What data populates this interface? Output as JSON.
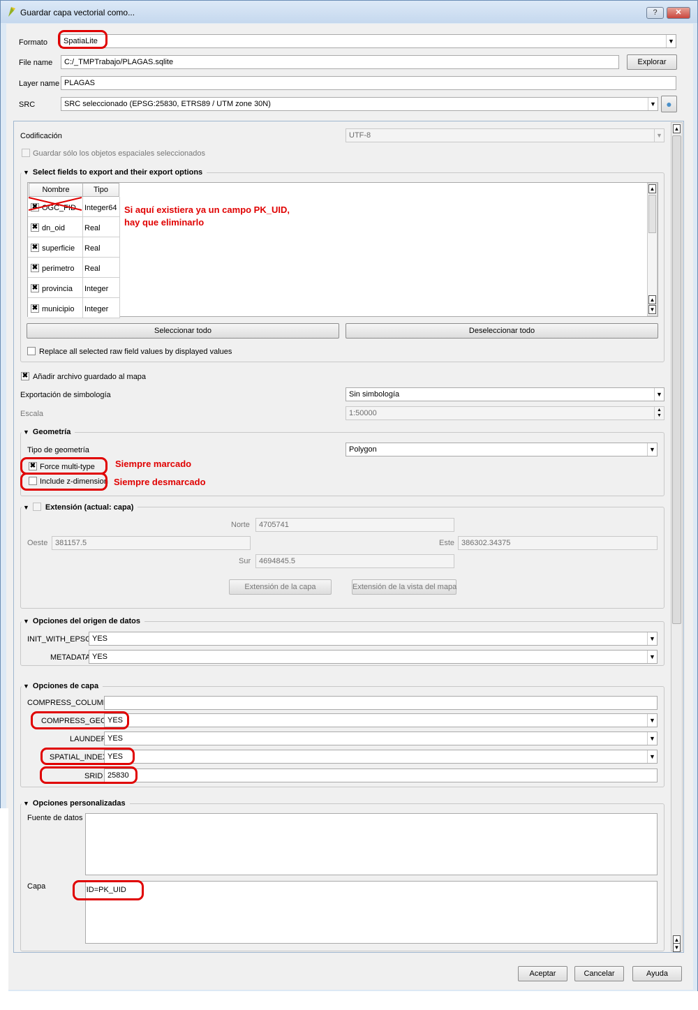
{
  "window": {
    "title": "Guardar capa vectorial como...",
    "help_label": "?",
    "close_label": "✕"
  },
  "top": {
    "format_label": "Formato",
    "format_value": "SpatiaLite",
    "filename_label": "File name",
    "filename_value": "C:/_TMPTrabajo/PLAGAS.sqlite",
    "browse_label": "Explorar",
    "layername_label": "Layer name",
    "layername_value": "PLAGAS",
    "src_label": "SRC",
    "src_value": "SRC seleccionado (EPSG:25830, ETRS89 / UTM zone 30N)"
  },
  "encoding": {
    "label": "Codificación",
    "value": "UTF-8",
    "selected_only_label": "Guardar sólo los objetos espaciales seleccionados"
  },
  "fields": {
    "title": "Select fields to export and their export options",
    "col_name": "Nombre",
    "col_type": "Tipo",
    "rows": [
      {
        "name": "OGC_FID",
        "type": "Integer64"
      },
      {
        "name": "dn_oid",
        "type": "Real"
      },
      {
        "name": "superficie",
        "type": "Real"
      },
      {
        "name": "perimetro",
        "type": "Real"
      },
      {
        "name": "provincia",
        "type": "Integer"
      },
      {
        "name": "municipio",
        "type": "Integer"
      }
    ],
    "select_all_label": "Seleccionar todo",
    "deselect_all_label": "Deseleccionar todo",
    "replace_label": "Replace all selected raw field values by displayed values"
  },
  "notes": {
    "pkuid_line1": "Si aquí existiera ya un campo PK_UID,",
    "pkuid_line2": "hay que eliminarlo",
    "always_checked": "Siempre marcado",
    "always_unchecked": "Siempre desmarcado"
  },
  "options": {
    "add_to_map_label": "Añadir archivo guardado al mapa",
    "symbology_label": "Exportación de simbología",
    "symbology_value": "Sin simbología",
    "scale_label": "Escala",
    "scale_value": "1:50000"
  },
  "geometry": {
    "title": "Geometría",
    "type_label": "Tipo de geometría",
    "type_value": "Polygon",
    "force_multi_label": "Force multi-type",
    "include_z_label": "Include z-dimension"
  },
  "extent": {
    "title": "Extensión (actual: capa)",
    "north_label": "Norte",
    "north_value": "4705741",
    "west_label": "Oeste",
    "west_value": "381157.5",
    "east_label": "Este",
    "east_value": "386302.34375",
    "south_label": "Sur",
    "south_value": "4694845.5",
    "layer_extent_btn": "Extensión de la capa",
    "canvas_extent_btn": "Extensión de la vista del mapa"
  },
  "datasource_options": {
    "title": "Opciones del origen de datos",
    "init_label": "INIT_WITH_EPSG",
    "init_value": "YES",
    "metadata_label": "METADATA",
    "metadata_value": "YES"
  },
  "layer_options": {
    "title": "Opciones de capa",
    "compress_columns_label": "COMPRESS_COLUMNS",
    "compress_columns_value": "",
    "compress_geom_label": "COMPRESS_GEOM",
    "compress_geom_value": "YES",
    "launder_label": "LAUNDER",
    "launder_value": "YES",
    "spatial_index_label": "SPATIAL_INDEX",
    "spatial_index_value": "YES",
    "srid_label": "SRID",
    "srid_value": "25830"
  },
  "custom_options": {
    "title": "Opciones personalizadas",
    "datasource_label": "Fuente de datos",
    "datasource_value": "",
    "layer_label": "Capa",
    "layer_value": "FID=PK_UID"
  },
  "footer": {
    "accept": "Aceptar",
    "cancel": "Cancelar",
    "help": "Ayuda"
  },
  "colors": {
    "annotation_red": "#e00000",
    "title_bar": "#c5d8ee",
    "close_button": "#c9463d"
  }
}
